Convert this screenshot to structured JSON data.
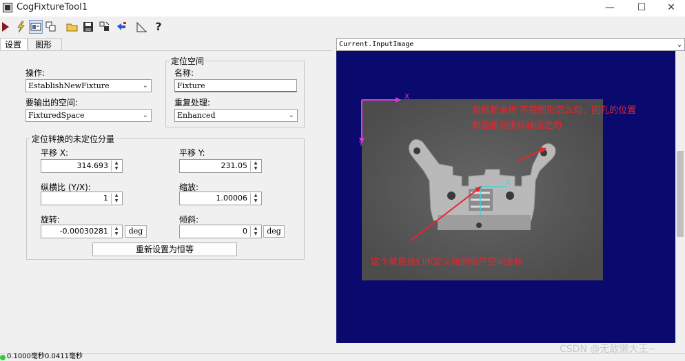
{
  "window": {
    "title": "CogFixtureTool1",
    "controls": [
      "—",
      "☐",
      "✕"
    ]
  },
  "toolbar": {
    "buttons": [
      "run-icon",
      "lightning-icon",
      "show-image-icon",
      "copy-icon",
      "open-icon",
      "save-icon",
      "graphics-icon",
      "reset-icon",
      "ruler-icon",
      "help-icon"
    ]
  },
  "tabs": [
    "设置",
    "图形"
  ],
  "settings": {
    "operation_label": "操作:",
    "operation_value": "EstablishNewFixture",
    "output_space_label": "要输出的空间:",
    "output_space_value": "FixturedSpace",
    "fixture_space_group": "定位空间",
    "name_label": "名称:",
    "name_value": "Fixture",
    "duplicate_label": "重复处理:",
    "duplicate_value": "Enhanced",
    "transform_group": "定位转换的未定位分量",
    "translation_x_label": "平移 X:",
    "translation_x_value": "314.693",
    "translation_y_label": "平移 Y:",
    "translation_y_value": "231.05",
    "aspect_label": "纵横比 (Y/X):",
    "aspect_value": "1",
    "scale_label": "缩放:",
    "scale_value": "1.00006",
    "rotation_label": "旋转:",
    "rotation_value": "-0.00030281",
    "skew_label": "倾斜:",
    "skew_value": "0",
    "deg_label": "deg",
    "reset_button": "重新设置为恒等"
  },
  "image": {
    "selector_value": "Current.InputImage",
    "annotation_top_line1": "根据新坐标 不管图形怎么动，圆孔的位置",
    "annotation_top_line2": "都是相对坐标轴固定的",
    "annotation_bottom": "这个就是我们所定义新的用户空间坐标",
    "axis_x_label": "X",
    "axis_y_label": "Y"
  },
  "statusbar": {
    "text": "0.1000毫秒0.0411毫秒"
  },
  "watermark": "CSDN @无敌懒大王~",
  "colors": {
    "display_bg": "#0a0a6e",
    "annotation": "#e8262e",
    "axis_magenta": "#d23ad8",
    "axis_cyan": "#3dd6d6"
  }
}
